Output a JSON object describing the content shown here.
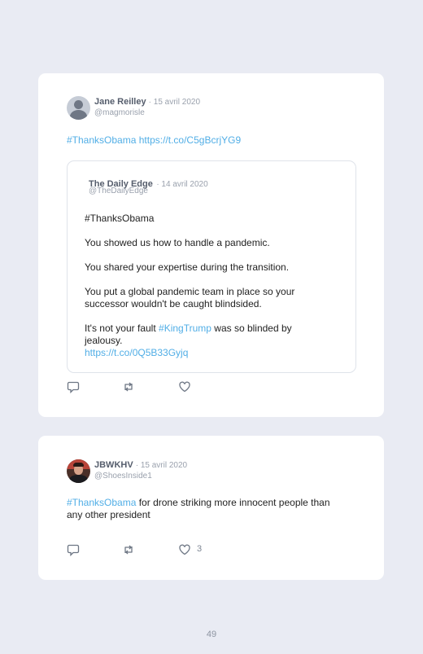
{
  "tweets": [
    {
      "author": "Jane Reilley",
      "date": "· 15 avril 2020",
      "handle": "@magmorisle",
      "text_tag": "#ThanksObama",
      "text_link": "https://t.co/C5gBcrjYG9",
      "quote": {
        "author": "The Daily Edge",
        "date": "· 14 avril 2020",
        "handle": "@TheDailyEdge",
        "tag": "#ThanksObama",
        "p1": "You showed us how to handle a pandemic.",
        "p2": "You shared your expertise during the transition.",
        "p3": "You put a global pandemic team in place so your successor wouldn't be caught blindsided.",
        "p4_pre": "It's not your fault ",
        "p4_tag": "#KingTrump",
        "p4_post": " was so blinded by jealousy.",
        "p4_link": "https://t.co/0Q5B33Gyjq"
      },
      "likes": ""
    },
    {
      "author": "JBWKHV",
      "date": "· 15 avril 2020",
      "handle": "@ShoesInside1",
      "text_tag": "#ThanksObama",
      "text_rest": " for drone striking more innocent people than any other president",
      "likes": "3"
    }
  ],
  "icons": {
    "reply": "reply-icon",
    "retweet": "retweet-icon",
    "like": "heart-icon"
  },
  "colors": {
    "link": "#51aee6",
    "background": "#e9ebf3",
    "card": "#ffffff"
  },
  "page_number": "49"
}
